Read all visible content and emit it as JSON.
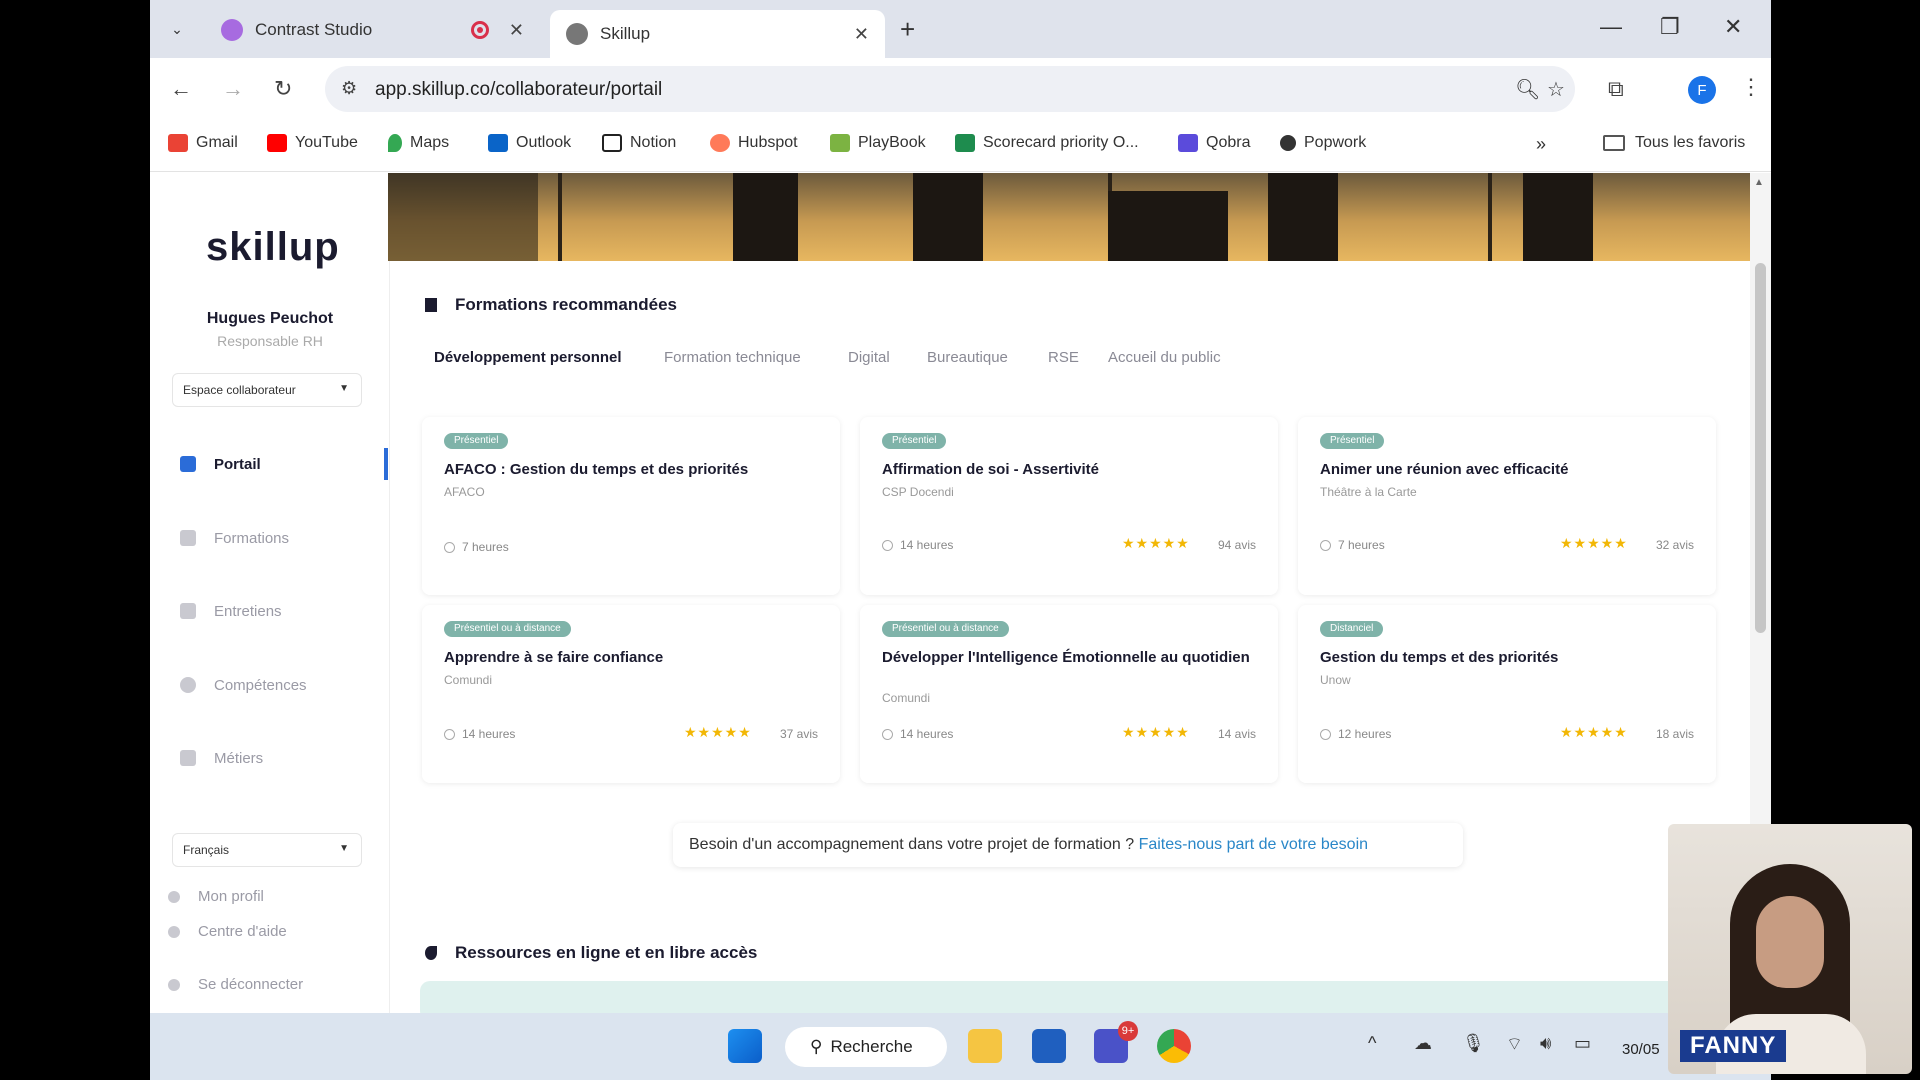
{
  "browser": {
    "tabs": [
      {
        "title": "Contrast Studio"
      },
      {
        "title": "Skillup"
      }
    ],
    "url": "app.skillup.co/collaborateur/portail",
    "profile_initial": "F",
    "bookmarks": [
      {
        "label": "Gmail",
        "color": "#ea4335"
      },
      {
        "label": "YouTube",
        "color": "#ff0000"
      },
      {
        "label": "Maps",
        "color": "#34a853"
      },
      {
        "label": "Outlook",
        "color": "#0a64c8"
      },
      {
        "label": "Notion",
        "color": "#222222"
      },
      {
        "label": "Hubspot",
        "color": "#ff7a59"
      },
      {
        "label": "PlayBook",
        "color": "#7cb342"
      },
      {
        "label": "Scorecard priority O...",
        "color": "#1e8c4e"
      },
      {
        "label": "Qobra",
        "color": "#5b4bdb"
      },
      {
        "label": "Popwork",
        "color": "#333333"
      }
    ],
    "all_bookmarks": "Tous les favoris"
  },
  "sidebar": {
    "logo": "skillup",
    "user_name": "Hugues Peuchot",
    "user_role": "Responsable RH",
    "space_select": "Espace collaborateur",
    "nav": [
      {
        "label": "Portail",
        "icon": "grid-icon",
        "active": true
      },
      {
        "label": "Formations",
        "icon": "graduation-cap-icon",
        "active": false
      },
      {
        "label": "Entretiens",
        "icon": "people-icon",
        "active": false
      },
      {
        "label": "Compétences",
        "icon": "badge-icon",
        "active": false
      },
      {
        "label": "Métiers",
        "icon": "briefcase-icon",
        "active": false
      }
    ],
    "language_select": "Français",
    "footer_links": [
      {
        "label": "Mon profil"
      },
      {
        "label": "Centre d'aide"
      },
      {
        "label": "Se déconnecter"
      }
    ]
  },
  "main": {
    "section_title": "Formations recommandées",
    "categories": [
      {
        "label": "Développement personnel",
        "active": true
      },
      {
        "label": "Formation technique"
      },
      {
        "label": "Digital"
      },
      {
        "label": "Bureautique"
      },
      {
        "label": "RSE"
      },
      {
        "label": "Accueil du public"
      }
    ],
    "courses": [
      {
        "badge": "Présentiel",
        "title": "AFACO : Gestion du temps et des priorités",
        "provider": "AFACO",
        "duration": "7 heures",
        "stars": "",
        "reviews": ""
      },
      {
        "badge": "Présentiel",
        "title": "Affirmation de soi - Assertivité",
        "provider": "CSP Docendi",
        "duration": "14 heures",
        "stars": "★★★★★",
        "reviews": "94 avis",
        "rating": 4.5
      },
      {
        "badge": "Présentiel",
        "title": "Animer une réunion avec efficacité",
        "provider": "Théâtre à la Carte",
        "duration": "7 heures",
        "stars": "★★★★★",
        "reviews": "32 avis",
        "rating": 4.5
      },
      {
        "badge": "Présentiel ou à distance",
        "title": "Apprendre à se faire confiance",
        "provider": "Comundi",
        "duration": "14 heures",
        "stars": "★★★★★",
        "reviews": "37 avis",
        "rating": 4.5
      },
      {
        "badge": "Présentiel ou à distance",
        "title": "Développer l'Intelligence Émotionnelle au quotidien",
        "provider": "Comundi",
        "duration": "14 heures",
        "stars": "★★★★★",
        "reviews": "14 avis",
        "rating": 4.5
      },
      {
        "badge": "Distanciel",
        "title": "Gestion du temps et des priorités",
        "provider": "Unow",
        "duration": "12 heures",
        "stars": "★★★★★",
        "reviews": "18 avis",
        "rating": 4.5
      }
    ],
    "need_text": "Besoin d'un accompagnement dans votre projet de formation ?",
    "need_link": "Faites-nous part de votre besoin",
    "resources_title": "Ressources en ligne et en libre accès"
  },
  "taskbar": {
    "search": "Recherche",
    "notification_count": "9+",
    "date": "30/05"
  },
  "webcam": {
    "name": "FANNY"
  }
}
